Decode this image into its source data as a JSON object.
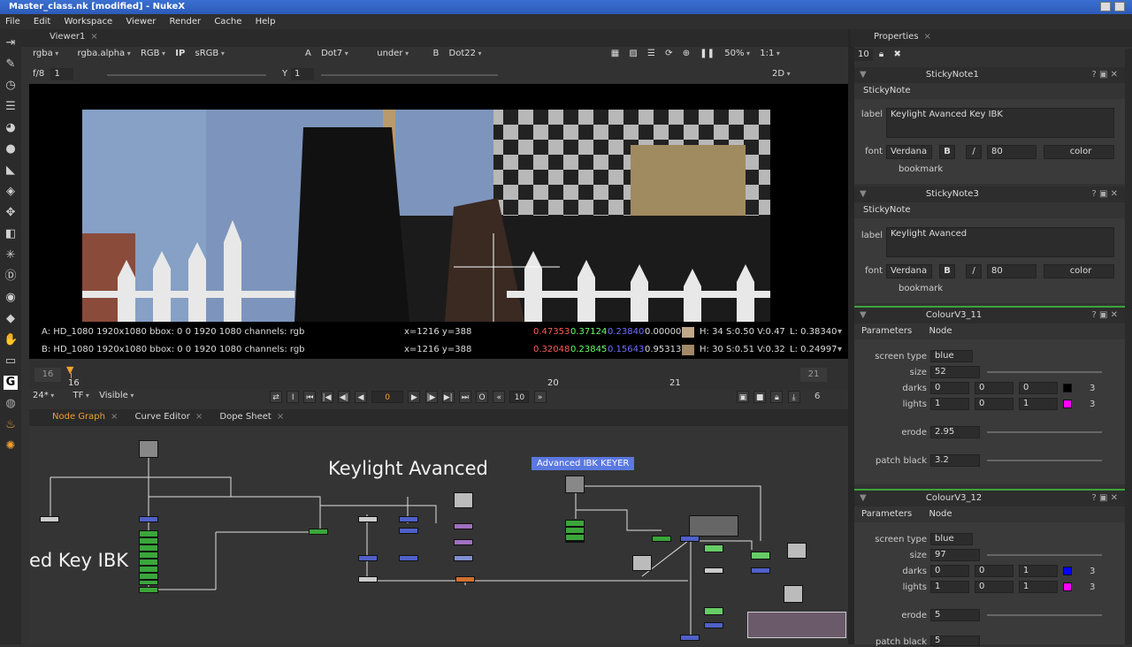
{
  "window": {
    "title": "Master_class.nk [modified] - NukeX"
  },
  "menu": [
    "File",
    "Edit",
    "Workspace",
    "Viewer",
    "Render",
    "Cache",
    "Help"
  ],
  "viewer": {
    "tab": "Viewer1",
    "channels": "rgba",
    "alpha": "rgba.alpha",
    "rgb": "RGB",
    "ip": "IP",
    "colorspace": "sRGB",
    "a_label": "A",
    "a_input": "Dot7",
    "mode": "under",
    "b_label": "B",
    "b_input": "Dot22",
    "zoom": "50%",
    "ratio": "1:1",
    "fstop": "f/8",
    "gain": "1",
    "y_label": "Y",
    "gamma": "1",
    "view2d": "2D",
    "info_a": {
      "prefix": "A:",
      "text": "HD_1080 1920x1080  bbox: 0 0 1920 1080 channels: rgb",
      "coords": "x=1216 y=388",
      "r": "0.47353",
      "g": "0.37124",
      "b": "0.23840",
      "a": "0.00000",
      "hsv": "H: 34 S:0.50 V:0.47",
      "l": "L: 0.38340"
    },
    "info_b": {
      "prefix": "B:",
      "text": "HD_1080 1920x1080  bbox: 0 0 1920 1080 channels: rgb",
      "coords": "x=1216 y=388",
      "r": "0.32048",
      "g": "0.23845",
      "b": "0.15643",
      "a": "0.95313",
      "hsv": "H: 30 S:0.51 V:0.32",
      "l": "L: 0.24997"
    }
  },
  "timeline": {
    "start": "16",
    "end": "21",
    "current": "16",
    "tick20": "20",
    "tick21": "21",
    "fps": "24*",
    "tf": "TF",
    "visible": "Visible",
    "frame": "0",
    "step": "10",
    "frames_right": "6"
  },
  "tabs_bottom": [
    "Node Graph",
    "Curve Editor",
    "Dope Sheet"
  ],
  "nodegraph": {
    "sticky1": "Keylight Avanced",
    "sticky2": "ed Key IBK",
    "backdrop": "Advanced IBK KEYER"
  },
  "properties": {
    "title": "Properties",
    "count": "10",
    "sticky_notes": [
      {
        "name": "StickyNote1",
        "class": "StickyNote",
        "label_lbl": "label",
        "label": "Keylight Avanced Key IBK",
        "font_lbl": "font",
        "font": "Verdana",
        "bold": "B",
        "italic": "/",
        "size": "80",
        "color_lbl": "color",
        "bookmark": "bookmark"
      },
      {
        "name": "StickyNote3",
        "class": "StickyNote",
        "label_lbl": "label",
        "label": "Keylight Avanced",
        "font_lbl": "font",
        "font": "Verdana",
        "bold": "B",
        "italic": "/",
        "size": "80",
        "color_lbl": "color",
        "bookmark": "bookmark"
      }
    ],
    "colour_nodes": [
      {
        "name": "ColourV3_11",
        "tabs": [
          "Parameters",
          "Node"
        ],
        "screen_type_lbl": "screen type",
        "screen_type": "blue",
        "size_lbl": "size",
        "size": "52",
        "darks_lbl": "darks",
        "darks": [
          "0",
          "0",
          "0"
        ],
        "lights_lbl": "lights",
        "lights": [
          "1",
          "0",
          "1"
        ],
        "erode_lbl": "erode",
        "erode": "2.95",
        "patch_lbl": "patch black",
        "patch": "3.2",
        "n3": "3"
      },
      {
        "name": "ColourV3_12",
        "tabs": [
          "Parameters",
          "Node"
        ],
        "screen_type_lbl": "screen type",
        "screen_type": "blue",
        "size_lbl": "size",
        "size": "97",
        "darks_lbl": "darks",
        "darks": [
          "0",
          "0",
          "1"
        ],
        "lights_lbl": "lights",
        "lights": [
          "1",
          "0",
          "1"
        ],
        "erode_lbl": "erode",
        "erode": "5",
        "patch_lbl": "patch black",
        "patch": "5",
        "n3": "3"
      }
    ]
  },
  "colors": {
    "accent_orange": "#f0a030",
    "node_green": "#3aa63a",
    "node_blue": "#5060c8",
    "backdrop_blue": "#5a78e0"
  }
}
